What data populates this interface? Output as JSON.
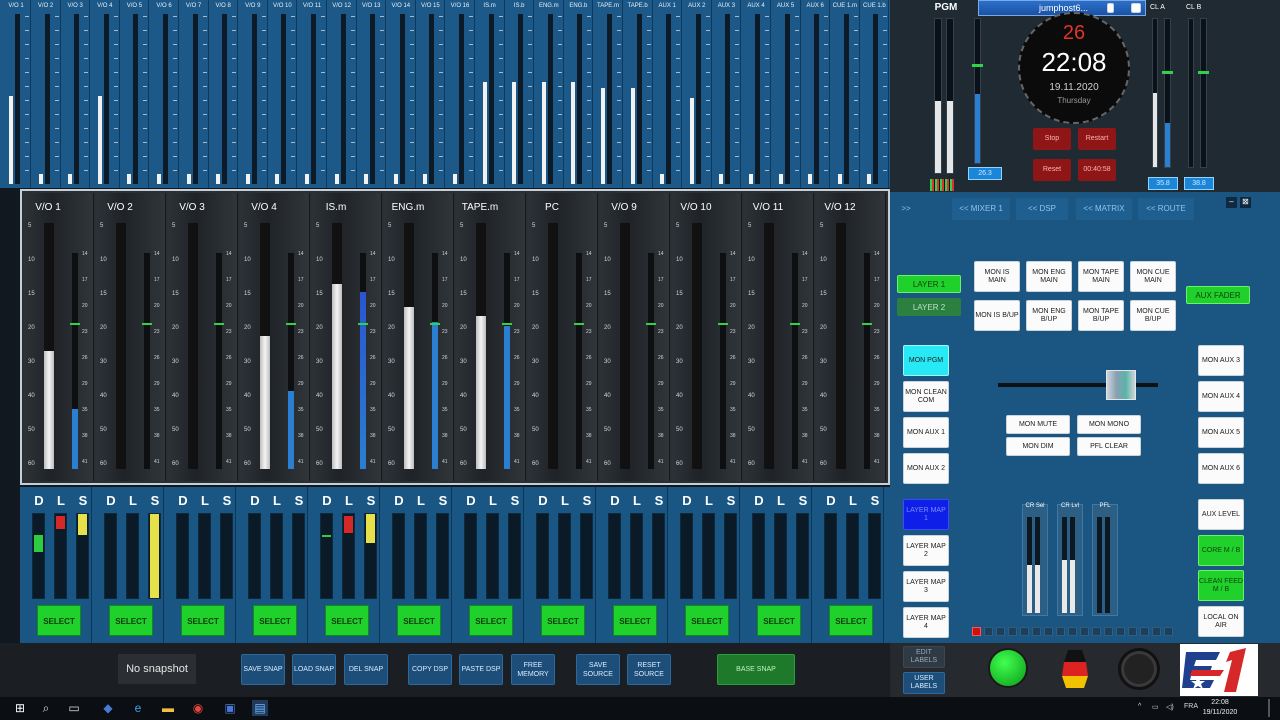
{
  "top_strip": {
    "channels": [
      {
        "label": "V/O 1",
        "level": 0.55
      },
      {
        "label": "V/O 2",
        "level": 0.06
      },
      {
        "label": "V/O 3",
        "level": 0.06
      },
      {
        "label": "V/O 4",
        "level": 0.55
      },
      {
        "label": "V/O 5",
        "level": 0.06
      },
      {
        "label": "V/O 6",
        "level": 0.06
      },
      {
        "label": "V/O 7",
        "level": 0.06
      },
      {
        "label": "V/O 8",
        "level": 0.06
      },
      {
        "label": "V/O 9",
        "level": 0.06
      },
      {
        "label": "V/O 10",
        "level": 0.06
      },
      {
        "label": "V/O 11",
        "level": 0.06
      },
      {
        "label": "V/O 12",
        "level": 0.06
      },
      {
        "label": "V/O 13",
        "level": 0.06
      },
      {
        "label": "V/O 14",
        "level": 0.06
      },
      {
        "label": "V/O 15",
        "level": 0.06
      },
      {
        "label": "V/O 16",
        "level": 0.06
      },
      {
        "label": "IS.m",
        "level": 0.64
      },
      {
        "label": "IS.b",
        "level": 0.64
      },
      {
        "label": "ENG.m",
        "level": 0.64
      },
      {
        "label": "ENG.b",
        "level": 0.64
      },
      {
        "label": "TAPE.m",
        "level": 0.6
      },
      {
        "label": "TAPE.b",
        "level": 0.6
      },
      {
        "label": "AUX 1",
        "level": 0.06
      },
      {
        "label": "AUX 2",
        "level": 0.54
      },
      {
        "label": "AUX 3",
        "level": 0.06
      },
      {
        "label": "AUX 4",
        "level": 0.06
      },
      {
        "label": "AUX 5",
        "level": 0.06
      },
      {
        "label": "AUX 6",
        "level": 0.06
      },
      {
        "label": "CUE 1.m",
        "level": 0.06
      },
      {
        "label": "CUE 1.b",
        "level": 0.06
      }
    ]
  },
  "pgm": {
    "label": "PGM",
    "readout": "26.3"
  },
  "window": {
    "title": "jumphost6..."
  },
  "clock": {
    "seconds": "26",
    "time": "22:08",
    "date": "19.11.2020",
    "day": "Thursday"
  },
  "timer": {
    "stop": "Stop",
    "restart": "Restart",
    "reset": "Reset",
    "elapsed": "00:40:58"
  },
  "cl": {
    "a_label": "CL A",
    "b_label": "CL B",
    "a_readout": "35.8",
    "b_readout": "38.8"
  },
  "mixer": {
    "scale_fader": [
      "5",
      "10",
      "15",
      "20",
      "30",
      "40",
      "50",
      "60"
    ],
    "scale_meter": [
      "14",
      "17",
      "20",
      "23",
      "26",
      "29",
      "35",
      "38",
      "41"
    ],
    "channels": [
      {
        "name": "V/O 1",
        "fader": 0.48,
        "meter": 0.28
      },
      {
        "name": "V/O 2",
        "fader": 0.0,
        "meter": 0.0
      },
      {
        "name": "V/O 3",
        "fader": 0.0,
        "meter": 0.0
      },
      {
        "name": "V/O 4",
        "fader": 0.54,
        "meter": 0.36
      },
      {
        "name": "IS.m",
        "fader": 0.75,
        "meter": 0.82
      },
      {
        "name": "ENG.m",
        "fader": 0.66,
        "meter": 0.68
      },
      {
        "name": "TAPE.m",
        "fader": 0.62,
        "meter": 0.66
      },
      {
        "name": "PC",
        "fader": 0.0,
        "meter": 0.0
      },
      {
        "name": "V/O 9",
        "fader": 0.0,
        "meter": 0.0
      },
      {
        "name": "V/O 10",
        "fader": 0.0,
        "meter": 0.0
      },
      {
        "name": "V/O 11",
        "fader": 0.0,
        "meter": 0.0
      },
      {
        "name": "V/O 12",
        "fader": 0.0,
        "meter": 0.0
      }
    ]
  },
  "dls": {
    "d": "D",
    "l": "L",
    "s": "S",
    "select": "SELECT",
    "channels": [
      {
        "d": 0.2,
        "l": 0.15,
        "s": 0.25,
        "dc": "#2ecc40",
        "lc": "#d62828",
        "sc": "#e6e04a"
      },
      {
        "d": 0,
        "l": 0,
        "s": 1.0,
        "dc": "",
        "lc": "",
        "sc": "#e6e04a"
      },
      {
        "d": 0,
        "l": 0,
        "s": 0,
        "dc": "",
        "lc": "",
        "sc": ""
      },
      {
        "d": 0,
        "l": 0,
        "s": 0,
        "dc": "",
        "lc": "",
        "sc": ""
      },
      {
        "d": 0.02,
        "l": 0.2,
        "s": 0.35,
        "dc": "#2ecc40",
        "lc": "#d62828",
        "sc": "#e6e04a"
      },
      {
        "d": 0,
        "l": 0,
        "s": 0,
        "dc": "",
        "lc": "",
        "sc": ""
      },
      {
        "d": 0,
        "l": 0,
        "s": 0,
        "dc": "",
        "lc": "",
        "sc": ""
      },
      {
        "d": 0,
        "l": 0,
        "s": 0,
        "dc": "",
        "lc": "",
        "sc": ""
      },
      {
        "d": 0,
        "l": 0,
        "s": 0,
        "dc": "",
        "lc": "",
        "sc": ""
      },
      {
        "d": 0,
        "l": 0,
        "s": 0,
        "dc": "",
        "lc": "",
        "sc": ""
      },
      {
        "d": 0,
        "l": 0,
        "s": 0,
        "dc": "",
        "lc": "",
        "sc": ""
      },
      {
        "d": 0,
        "l": 0,
        "s": 0,
        "dc": "",
        "lc": "",
        "sc": ""
      }
    ]
  },
  "snapshot": {
    "status": "No snapshot",
    "save": "SAVE SNAP",
    "load": "LOAD SNAP",
    "del": "DEL SNAP",
    "copy": "COPY DSP",
    "paste": "PASTE DSP",
    "free": "FREE MEMORY",
    "save_source": "SAVE SOURCE",
    "reset_source": "RESET SOURCE",
    "base": "BASE SNAP"
  },
  "nav": {
    "expand": ">>",
    "mixer": "<< MIXER 1",
    "dsp": "<< DSP",
    "matrix": "<< MATRIX",
    "route": "<< ROUTE"
  },
  "right": {
    "layer1": "LAYER 1",
    "layer2": "LAYER 2",
    "aux_fader": "AUX FADER",
    "mon_grid": [
      "MON IS MAIN",
      "MON ENG MAIN",
      "MON TAPE MAIN",
      "MON CUE MAIN",
      "MON IS B/UP",
      "MON ENG B/UP",
      "MON TAPE B/UP",
      "MON CUE B/UP"
    ],
    "mon_left": [
      "MON PGM",
      "MON CLEAN COM",
      "MON AUX 1",
      "MON AUX 2"
    ],
    "mon_right": [
      "MON AUX 3",
      "MON AUX 4",
      "MON AUX 5",
      "MON AUX 6"
    ],
    "mon_mid": [
      "MON MUTE",
      "MON MONO",
      "MON DIM",
      "PFL CLEAR"
    ],
    "layer_map": [
      "LAYER MAP 1",
      "LAYER MAP 2",
      "LAYER MAP 3",
      "LAYER MAP 4"
    ],
    "aux_level": "AUX LEVEL",
    "core": "CORE M / B",
    "clean_feed": "CLEAN FEED M / B",
    "local": "LOCAL ON AIR",
    "meters": [
      {
        "label": "CR Sel",
        "level": 0.5
      },
      {
        "label": "CR Lvl",
        "level": 0.55
      },
      {
        "label": "PFL",
        "level": 0.0
      }
    ],
    "edit_labels": "EDIT LABELS",
    "user_labels": "USER LABELS"
  },
  "taskbar": {
    "lang": "FRA",
    "time": "22:08",
    "date": "19/11/2020"
  }
}
